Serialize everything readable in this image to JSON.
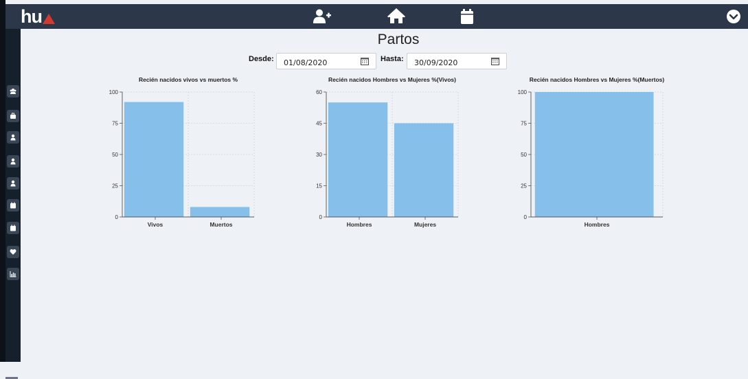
{
  "app": {
    "logo_text": "hu",
    "colors": {
      "topbar": "#2c3849",
      "sidebar": "#16202c",
      "accent": "#d23a2f",
      "bar": "#86c0ea"
    }
  },
  "topbar": {
    "icons": [
      "add-user-icon",
      "home-icon",
      "calendar-icon"
    ],
    "menu_icon": "chevron-down-circle-icon"
  },
  "sidebar": {
    "items": [
      "users-icon",
      "briefcase-icon",
      "user-icon",
      "user-icon",
      "user-icon",
      "calendar-icon",
      "calendar-icon",
      "heart-icon",
      "chart-icon"
    ]
  },
  "page": {
    "title": "Partos",
    "desde_label": "Desde:",
    "desde_value": "01/08/2020",
    "hasta_label": "Hasta:",
    "hasta_value": "30/09/2020"
  },
  "chart_data": [
    {
      "type": "bar",
      "title": "Recién nacidos vivos vs muertos %",
      "categories": [
        "Vivos",
        "Muertos"
      ],
      "values": [
        92,
        8
      ],
      "ylim": [
        0,
        100
      ],
      "yticks": [
        0,
        25,
        50,
        75,
        100
      ],
      "grid": true
    },
    {
      "type": "bar",
      "title": "Recién nacidos Hombres vs Mujeres %(Vivos)",
      "categories": [
        "Hombres",
        "Mujeres"
      ],
      "values": [
        55,
        45
      ],
      "ylim": [
        0,
        60
      ],
      "yticks": [
        0,
        15,
        30,
        45,
        60
      ],
      "grid": true
    },
    {
      "type": "bar",
      "title": "Recién nacidos Hombres vs Mujeres %(Muertos)",
      "categories": [
        "Hombres"
      ],
      "values": [
        100
      ],
      "ylim": [
        0,
        100
      ],
      "yticks": [
        0,
        25,
        50,
        75,
        100
      ],
      "grid": true
    }
  ]
}
